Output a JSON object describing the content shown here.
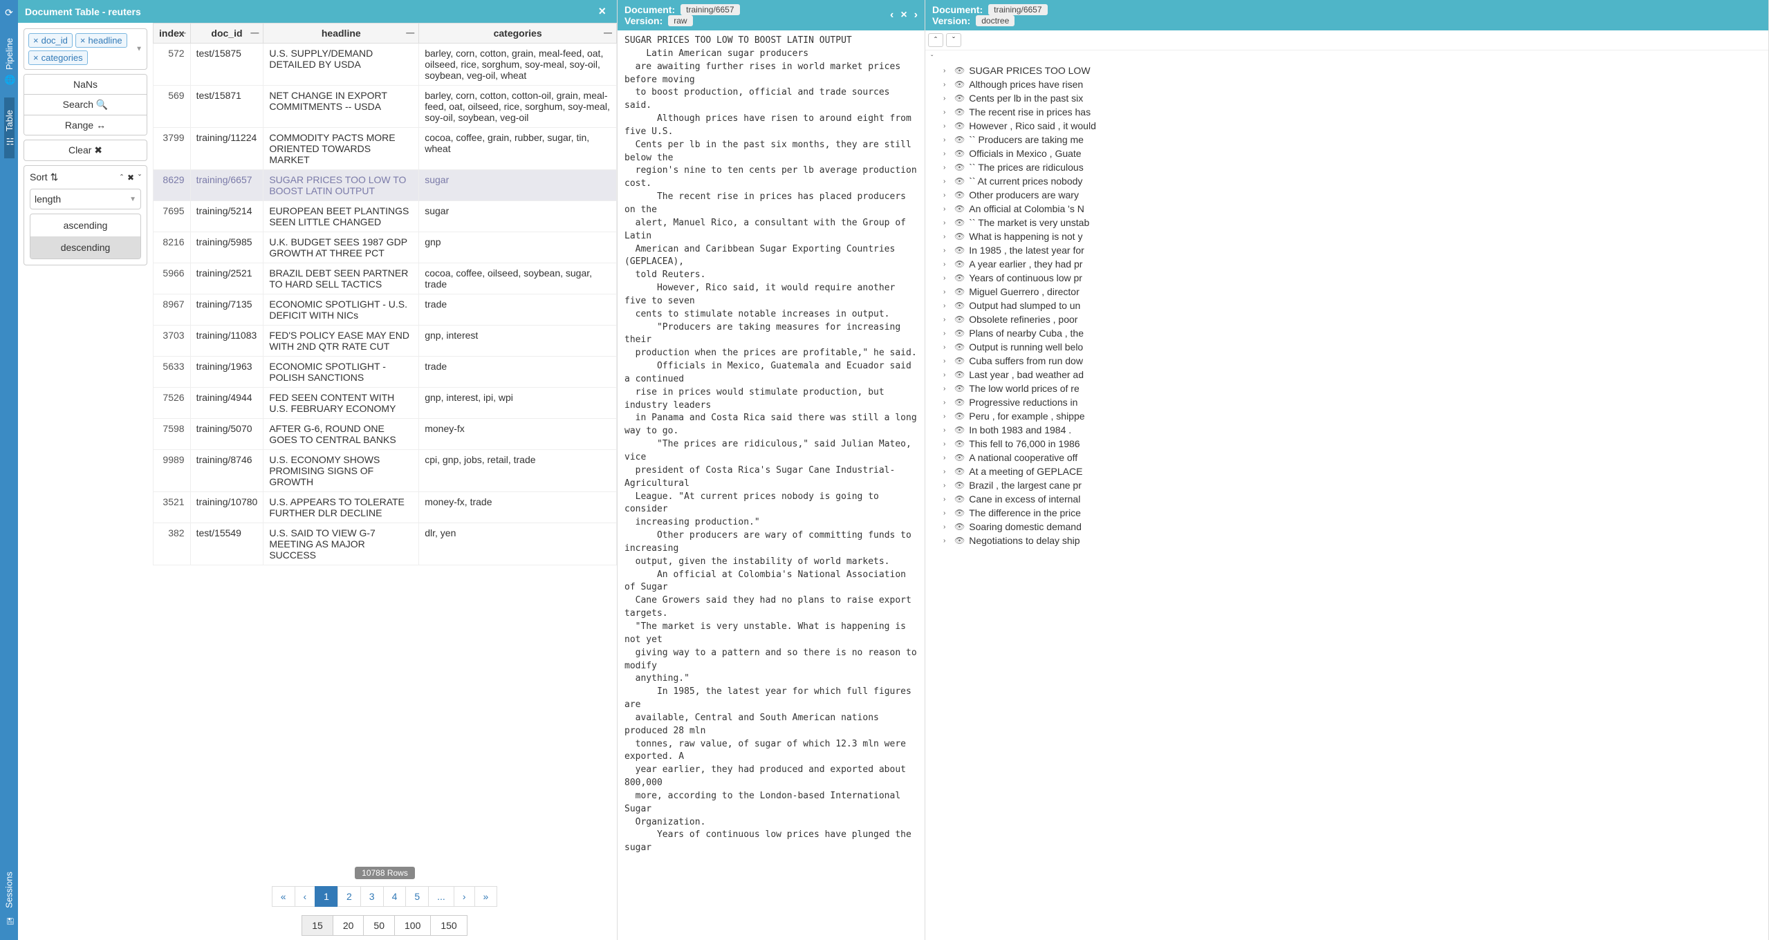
{
  "sidebar": {
    "tabs": [
      "Pipeline",
      "Table",
      "Sessions"
    ],
    "active": 1
  },
  "tablePanel": {
    "title": "Document Table - reuters",
    "chips": [
      "doc_id",
      "headline",
      "categories"
    ],
    "buttons": {
      "nans": "NaNs",
      "search": "Search",
      "range": "Range",
      "clear": "Clear"
    },
    "sort": {
      "label": "Sort",
      "field": "length",
      "options": [
        "ascending",
        "descending"
      ],
      "selected": "descending"
    },
    "columns": [
      "index",
      "doc_id",
      "headline",
      "categories"
    ],
    "rows": [
      {
        "index": 572,
        "doc_id": "test/15875",
        "headline": "U.S. SUPPLY/DEMAND DETAILED BY USDA",
        "categories": "barley, corn, cotton, grain, meal-feed, oat, oilseed, rice, sorghum, soy-meal, soy-oil, soybean, veg-oil, wheat"
      },
      {
        "index": 569,
        "doc_id": "test/15871",
        "headline": "NET CHANGE IN EXPORT COMMITMENTS -- USDA",
        "categories": "barley, corn, cotton, cotton-oil, grain, meal-feed, oat, oilseed, rice, sorghum, soy-meal, soy-oil, soybean, veg-oil"
      },
      {
        "index": 3799,
        "doc_id": "training/11224",
        "headline": "COMMODITY PACTS MORE ORIENTED TOWARDS MARKET",
        "categories": "cocoa, coffee, grain, rubber, sugar, tin, wheat"
      },
      {
        "index": 8629,
        "doc_id": "training/6657",
        "headline": "SUGAR PRICES TOO LOW TO BOOST LATIN OUTPUT",
        "categories": "sugar",
        "selected": true
      },
      {
        "index": 7695,
        "doc_id": "training/5214",
        "headline": "EUROPEAN BEET PLANTINGS SEEN LITTLE CHANGED",
        "categories": "sugar"
      },
      {
        "index": 8216,
        "doc_id": "training/5985",
        "headline": "U.K. BUDGET SEES 1987 GDP GROWTH AT THREE PCT",
        "categories": "gnp"
      },
      {
        "index": 5966,
        "doc_id": "training/2521",
        "headline": "BRAZIL DEBT SEEN PARTNER TO HARD SELL TACTICS",
        "categories": "cocoa, coffee, oilseed, soybean, sugar, trade"
      },
      {
        "index": 8967,
        "doc_id": "training/7135",
        "headline": "ECONOMIC SPOTLIGHT - U.S. DEFICIT WITH NICs",
        "categories": "trade"
      },
      {
        "index": 3703,
        "doc_id": "training/11083",
        "headline": "FED'S POLICY EASE MAY END WITH 2ND QTR RATE CUT",
        "categories": "gnp, interest"
      },
      {
        "index": 5633,
        "doc_id": "training/1963",
        "headline": "ECONOMIC SPOTLIGHT - POLISH SANCTIONS",
        "categories": "trade"
      },
      {
        "index": 7526,
        "doc_id": "training/4944",
        "headline": "FED SEEN CONTENT WITH U.S. FEBRUARY ECONOMY",
        "categories": "gnp, interest, ipi, wpi"
      },
      {
        "index": 7598,
        "doc_id": "training/5070",
        "headline": "AFTER G-6, ROUND ONE GOES TO CENTRAL BANKS",
        "categories": "money-fx"
      },
      {
        "index": 9989,
        "doc_id": "training/8746",
        "headline": "U.S. ECONOMY SHOWS PROMISING SIGNS OF GROWTH",
        "categories": "cpi, gnp, jobs, retail, trade"
      },
      {
        "index": 3521,
        "doc_id": "training/10780",
        "headline": "U.S. APPEARS TO TOLERATE FURTHER DLR DECLINE",
        "categories": "money-fx, trade"
      },
      {
        "index": 382,
        "doc_id": "test/15549",
        "headline": "U.S. SAID TO VIEW G-7 MEETING AS MAJOR SUCCESS",
        "categories": "dlr, yen"
      }
    ],
    "rowCount": "10788 Rows",
    "pages": [
      "«",
      "‹",
      "1",
      "2",
      "3",
      "4",
      "5",
      "...",
      "›",
      "»"
    ],
    "activePage": "1",
    "sizes": [
      "15",
      "20",
      "50",
      "100",
      "150"
    ],
    "activeSize": "15"
  },
  "docPanel": {
    "docLabel": "Document:",
    "docId": "training/6657",
    "verLabel": "Version:",
    "version": "raw",
    "text": "SUGAR PRICES TOO LOW TO BOOST LATIN OUTPUT\n    Latin American sugar producers\n  are awaiting further rises in world market prices before moving\n  to boost production, official and trade sources said.\n      Although prices have risen to around eight from five U.S.\n  Cents per lb in the past six months, they are still below the\n  region's nine to ten cents per lb average production cost.\n      The recent rise in prices has placed producers on the\n  alert, Manuel Rico, a consultant with the Group of Latin\n  American and Caribbean Sugar Exporting Countries (GEPLACEA),\n  told Reuters.\n      However, Rico said, it would require another five to seven\n  cents to stimulate notable increases in output.\n      \"Producers are taking measures for increasing their\n  production when the prices are profitable,\" he said.\n      Officials in Mexico, Guatemala and Ecuador said a continued\n  rise in prices would stimulate production, but industry leaders\n  in Panama and Costa Rica said there was still a long way to go.\n      \"The prices are ridiculous,\" said Julian Mateo, vice\n  president of Costa Rica's Sugar Cane Industrial-Agricultural\n  League. \"At current prices nobody is going to consider\n  increasing production.\"\n      Other producers are wary of committing funds to increasing\n  output, given the instability of world markets.\n      An official at Colombia's National Association of Sugar\n  Cane Growers said they had no plans to raise export targets.\n  \"The market is very unstable. What is happening is not yet\n  giving way to a pattern and so there is no reason to modify\n  anything.\"\n      In 1985, the latest year for which full figures are\n  available, Central and South American nations produced 28 mln\n  tonnes, raw value, of sugar of which 12.3 mln were exported. A\n  year earlier, they had produced and exported about 800,000\n  more, according to the London-based International Sugar\n  Organization.\n      Years of continuous low prices have plunged the sugar"
  },
  "treePanel": {
    "docLabel": "Document:",
    "docId": "training/6657",
    "verLabel": "Version:",
    "version": "doctree",
    "items": [
      "SUGAR PRICES TOO LOW",
      "Although prices have risen",
      "Cents per lb in the past six",
      "The recent rise in prices has",
      "However , Rico said , it would",
      "`` Producers are taking me",
      "Officials in Mexico , Guate",
      "`` The prices are ridiculous",
      "`` At current prices nobody",
      "Other producers are wary",
      "An official at Colombia 's N",
      "`` The market is very unstab",
      "What is happening is not y",
      "In 1985 , the latest year for",
      "A year earlier , they had pr",
      "Years of continuous low pr",
      "Miguel Guerrero , director",
      "Output had slumped to un",
      "Obsolete refineries , poor",
      "Plans of nearby Cuba , the",
      "Output is running well belo",
      "Cuba suffers from run dow",
      "Last year , bad weather ad",
      "The low world prices of re",
      "Progressive reductions in",
      "Peru , for example , shippe",
      "In both 1983 and 1984 .",
      "This fell to 76,000 in 1986",
      "A national cooperative off",
      "At a meeting of GEPLACE",
      "Brazil , the largest cane pr",
      "Cane in excess of internal",
      "The difference in the price",
      "Soaring domestic demand",
      "Negotiations to delay ship"
    ]
  }
}
